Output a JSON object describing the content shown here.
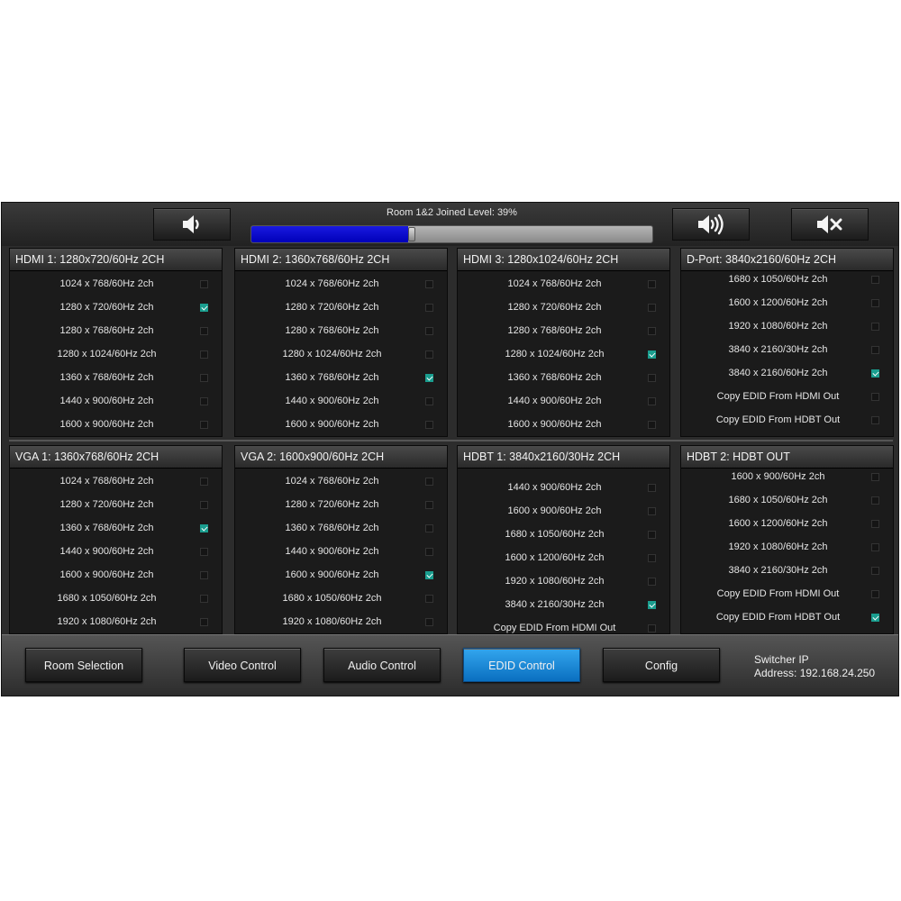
{
  "volume": {
    "label": "Room 1&2 Joined Level: 39%",
    "level_percent": 39
  },
  "panels": [
    {
      "title": "HDMI 1: 1280x720/60Hz 2CH",
      "top_offset": 0,
      "options": [
        {
          "label": "1024 x 768/60Hz 2ch",
          "checked": false
        },
        {
          "label": "1280 x 720/60Hz 2ch",
          "checked": true
        },
        {
          "label": "1280 x 768/60Hz 2ch",
          "checked": false
        },
        {
          "label": "1280 x 1024/60Hz 2ch",
          "checked": false
        },
        {
          "label": "1360 x 768/60Hz 2ch",
          "checked": false
        },
        {
          "label": "1440 x 900/60Hz 2ch",
          "checked": false
        },
        {
          "label": "1600 x 900/60Hz 2ch",
          "checked": false
        }
      ]
    },
    {
      "title": "HDMI 2: 1360x768/60Hz 2CH",
      "options": [
        {
          "label": "1024 x 768/60Hz 2ch",
          "checked": false
        },
        {
          "label": "1280 x 720/60Hz 2ch",
          "checked": false
        },
        {
          "label": "1280 x 768/60Hz 2ch",
          "checked": false
        },
        {
          "label": "1280 x 1024/60Hz 2ch",
          "checked": false
        },
        {
          "label": "1360 x 768/60Hz 2ch",
          "checked": true
        },
        {
          "label": "1440 x 900/60Hz 2ch",
          "checked": false
        },
        {
          "label": "1600 x 900/60Hz 2ch",
          "checked": false
        }
      ]
    },
    {
      "title": "HDMI 3: 1280x1024/60Hz 2CH",
      "options": [
        {
          "label": "1024 x 768/60Hz 2ch",
          "checked": false
        },
        {
          "label": "1280 x 720/60Hz 2ch",
          "checked": false
        },
        {
          "label": "1280 x 768/60Hz 2ch",
          "checked": false
        },
        {
          "label": "1280 x 1024/60Hz 2ch",
          "checked": true
        },
        {
          "label": "1360 x 768/60Hz 2ch",
          "checked": false
        },
        {
          "label": "1440 x 900/60Hz 2ch",
          "checked": false
        },
        {
          "label": "1600 x 900/60Hz 2ch",
          "checked": false
        }
      ]
    },
    {
      "title": "D-Port: 3840x2160/60Hz 2CH",
      "options": [
        {
          "label": "1680 x 1050/60Hz 2ch",
          "checked": false
        },
        {
          "label": "1600 x 1200/60Hz 2ch",
          "checked": false
        },
        {
          "label": "1920 x 1080/60Hz 2ch",
          "checked": false
        },
        {
          "label": "3840 x 2160/30Hz 2ch",
          "checked": false
        },
        {
          "label": "3840 x 2160/60Hz 2ch",
          "checked": true
        },
        {
          "label": "Copy EDID From HDMI Out",
          "checked": false
        },
        {
          "label": "Copy EDID From HDBT Out",
          "checked": false
        }
      ]
    },
    {
      "title": "VGA 1: 1360x768/60Hz 2CH",
      "options": [
        {
          "label": "1024 x 768/60Hz 2ch",
          "checked": false
        },
        {
          "label": "1280 x 720/60Hz 2ch",
          "checked": false
        },
        {
          "label": "1360 x 768/60Hz 2ch",
          "checked": true
        },
        {
          "label": "1440 x 900/60Hz 2ch",
          "checked": false
        },
        {
          "label": "1600 x 900/60Hz 2ch",
          "checked": false
        },
        {
          "label": "1680 x 1050/60Hz 2ch",
          "checked": false
        },
        {
          "label": "1920 x 1080/60Hz 2ch",
          "checked": false
        }
      ]
    },
    {
      "title": "VGA 2: 1600x900/60Hz 2CH",
      "options": [
        {
          "label": "1024 x 768/60Hz 2ch",
          "checked": false
        },
        {
          "label": "1280 x 720/60Hz 2ch",
          "checked": false
        },
        {
          "label": "1360 x 768/60Hz 2ch",
          "checked": false
        },
        {
          "label": "1440 x 900/60Hz 2ch",
          "checked": false
        },
        {
          "label": "1600 x 900/60Hz 2ch",
          "checked": true
        },
        {
          "label": "1680 x 1050/60Hz 2ch",
          "checked": false
        },
        {
          "label": "1920 x 1080/60Hz 2ch",
          "checked": false
        }
      ]
    },
    {
      "title": "HDBT 1: 3840x2160/30Hz 2CH",
      "options": [
        {
          "label": "1440 x 900/60Hz 2ch",
          "checked": false
        },
        {
          "label": "1600 x 900/60Hz 2ch",
          "checked": false
        },
        {
          "label": "1680 x 1050/60Hz 2ch",
          "checked": false
        },
        {
          "label": "1600 x 1200/60Hz 2ch",
          "checked": false
        },
        {
          "label": "1920 x 1080/60Hz 2ch",
          "checked": false
        },
        {
          "label": "3840 x 2160/30Hz 2ch",
          "checked": true
        },
        {
          "label": "Copy EDID From HDMI Out",
          "checked": false
        }
      ]
    },
    {
      "title": "HDBT 2: HDBT OUT",
      "options": [
        {
          "label": "1600 x 900/60Hz 2ch",
          "checked": false
        },
        {
          "label": "1680 x 1050/60Hz 2ch",
          "checked": false
        },
        {
          "label": "1600 x 1200/60Hz 2ch",
          "checked": false
        },
        {
          "label": "1920 x 1080/60Hz 2ch",
          "checked": false
        },
        {
          "label": "3840 x 2160/30Hz 2ch",
          "checked": false
        },
        {
          "label": "Copy EDID From HDMI Out",
          "checked": false
        },
        {
          "label": "Copy EDID From HDBT Out",
          "checked": true
        }
      ]
    }
  ],
  "nav": [
    {
      "label": "Room Selection",
      "active": false
    },
    {
      "label": "Video Control",
      "active": false
    },
    {
      "label": "Audio Control",
      "active": false
    },
    {
      "label": "EDID Control",
      "active": true
    },
    {
      "label": "Config",
      "active": false
    }
  ],
  "switcher_ip": {
    "line1": "Switcher IP",
    "line2": "Address: 192.168.24.250"
  },
  "icons": {
    "vol_down": "speaker-low-icon",
    "vol_up": "speaker-high-icon",
    "mute": "speaker-mute-icon"
  },
  "colors": {
    "accent_active": "#1a8fd8",
    "checkbox_on": "#1a9e8f",
    "volume_fill": "#0000d0"
  }
}
